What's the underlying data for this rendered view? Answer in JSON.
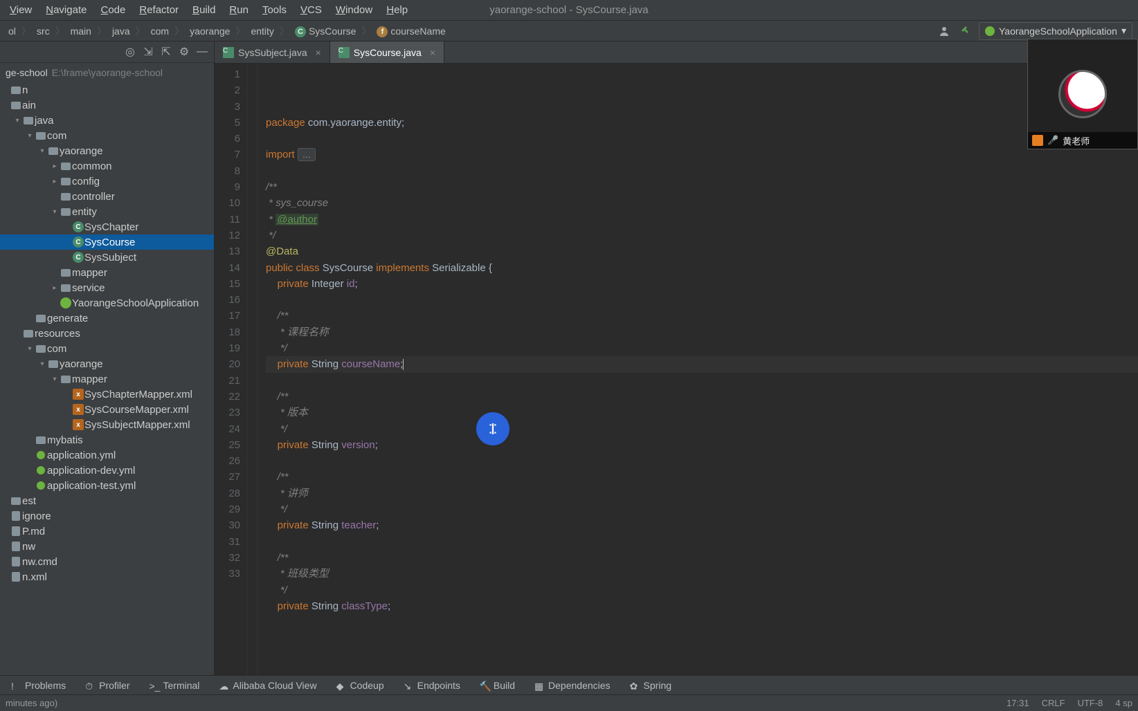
{
  "window_title": "yaorange-school - SysCourse.java",
  "menu": [
    "View",
    "Navigate",
    "Code",
    "Refactor",
    "Build",
    "Run",
    "Tools",
    "VCS",
    "Window",
    "Help"
  ],
  "breadcrumbs": {
    "parts": [
      "ol",
      "src",
      "main",
      "java",
      "com",
      "yaorange",
      "entity"
    ],
    "class_name": "SysCourse",
    "field_name": "courseName"
  },
  "run_config": "YaorangeSchoolApplication",
  "sidebar": {
    "project_name": "ge-school",
    "project_path": "E:\\frame\\yaorange-school",
    "tree": [
      {
        "depth": 0,
        "label": "n",
        "kind": "dir",
        "arrow": ""
      },
      {
        "depth": 0,
        "label": "ain",
        "kind": "dir",
        "arrow": ""
      },
      {
        "depth": 1,
        "label": "java",
        "kind": "dir",
        "arrow": "▾"
      },
      {
        "depth": 2,
        "label": "com",
        "kind": "dir",
        "arrow": "▾"
      },
      {
        "depth": 3,
        "label": "yaorange",
        "kind": "dir",
        "arrow": "▾"
      },
      {
        "depth": 4,
        "label": "common",
        "kind": "dir",
        "arrow": "▸"
      },
      {
        "depth": 4,
        "label": "config",
        "kind": "dir",
        "arrow": "▸"
      },
      {
        "depth": 4,
        "label": "controller",
        "kind": "dir",
        "arrow": ""
      },
      {
        "depth": 4,
        "label": "entity",
        "kind": "dir",
        "arrow": "▾"
      },
      {
        "depth": 5,
        "label": "SysChapter",
        "kind": "class",
        "arrow": ""
      },
      {
        "depth": 5,
        "label": "SysCourse",
        "kind": "class",
        "arrow": "",
        "selected": true
      },
      {
        "depth": 5,
        "label": "SysSubject",
        "kind": "class",
        "arrow": ""
      },
      {
        "depth": 4,
        "label": "mapper",
        "kind": "dir",
        "arrow": ""
      },
      {
        "depth": 4,
        "label": "service",
        "kind": "dir",
        "arrow": "▸"
      },
      {
        "depth": 4,
        "label": "YaorangeSchoolApplication",
        "kind": "spring",
        "arrow": ""
      },
      {
        "depth": 2,
        "label": "generate",
        "kind": "dir",
        "arrow": ""
      },
      {
        "depth": 1,
        "label": "resources",
        "kind": "dir",
        "arrow": ""
      },
      {
        "depth": 2,
        "label": "com",
        "kind": "dir",
        "arrow": "▾"
      },
      {
        "depth": 3,
        "label": "yaorange",
        "kind": "dir",
        "arrow": "▾"
      },
      {
        "depth": 4,
        "label": "mapper",
        "kind": "dir",
        "arrow": "▾"
      },
      {
        "depth": 5,
        "label": "SysChapterMapper.xml",
        "kind": "xml",
        "arrow": ""
      },
      {
        "depth": 5,
        "label": "SysCourseMapper.xml",
        "kind": "xml",
        "arrow": ""
      },
      {
        "depth": 5,
        "label": "SysSubjectMapper.xml",
        "kind": "xml",
        "arrow": ""
      },
      {
        "depth": 2,
        "label": "mybatis",
        "kind": "dir",
        "arrow": ""
      },
      {
        "depth": 2,
        "label": "application.yml",
        "kind": "yml",
        "arrow": ""
      },
      {
        "depth": 2,
        "label": "application-dev.yml",
        "kind": "yml",
        "arrow": ""
      },
      {
        "depth": 2,
        "label": "application-test.yml",
        "kind": "yml",
        "arrow": ""
      },
      {
        "depth": 0,
        "label": "est",
        "kind": "dir",
        "arrow": ""
      },
      {
        "depth": 0,
        "label": "ignore",
        "kind": "txt",
        "arrow": ""
      },
      {
        "depth": 0,
        "label": "P.md",
        "kind": "txt",
        "arrow": ""
      },
      {
        "depth": 0,
        "label": "nw",
        "kind": "txt",
        "arrow": ""
      },
      {
        "depth": 0,
        "label": "nw.cmd",
        "kind": "txt",
        "arrow": ""
      },
      {
        "depth": 0,
        "label": "n.xml",
        "kind": "txt",
        "arrow": ""
      }
    ]
  },
  "tabs": [
    {
      "label": "SysSubject.java",
      "icon": "class",
      "active": false
    },
    {
      "label": "SysCourse.java",
      "icon": "class",
      "active": true
    }
  ],
  "code_lines": [
    {
      "n": 1,
      "html": "<span class='kw'>package</span> com.yaorange.entity;"
    },
    {
      "n": 2,
      "html": ""
    },
    {
      "n": 3,
      "html": "<span class='kw'>import</span> <span class='fold'>...</span>"
    },
    {
      "n": 5,
      "html": ""
    },
    {
      "n": 6,
      "html": "<span class='cmt'>/**</span>"
    },
    {
      "n": 7,
      "html": "<span class='cmt'> * sys_course</span>"
    },
    {
      "n": 8,
      "html": "<span class='cmt'> * </span><span class='doctag'>@author</span>"
    },
    {
      "n": 9,
      "html": "<span class='cmt'> */</span>"
    },
    {
      "n": 10,
      "html": "<span class='ann'>@Data</span>"
    },
    {
      "n": 11,
      "html": "<span class='kw'>public class</span> SysCourse <span class='kw'>implements</span> Serializable {"
    },
    {
      "n": 12,
      "html": "    <span class='kw'>private</span> Integer <span class='name'>id</span>;"
    },
    {
      "n": 13,
      "html": ""
    },
    {
      "n": 14,
      "html": "    <span class='cmt'>/**</span>"
    },
    {
      "n": 15,
      "html": "    <span class='cmt'> * 课程名称</span>"
    },
    {
      "n": 16,
      "html": "    <span class='cmt'> */</span>"
    },
    {
      "n": 17,
      "html": "    <span class='kw'>private</span> String <span class='name'>courseName</span>;<span class='caret'></span>",
      "current": true
    },
    {
      "n": 18,
      "html": ""
    },
    {
      "n": 19,
      "html": "    <span class='cmt'>/**</span>"
    },
    {
      "n": 20,
      "html": "    <span class='cmt'> * 版本</span>"
    },
    {
      "n": 21,
      "html": "    <span class='cmt'> */</span>"
    },
    {
      "n": 22,
      "html": "    <span class='kw'>private</span> String <span class='name'>version</span>;"
    },
    {
      "n": 23,
      "html": ""
    },
    {
      "n": 24,
      "html": "    <span class='cmt'>/**</span>"
    },
    {
      "n": 25,
      "html": "    <span class='cmt'> * 讲师</span>"
    },
    {
      "n": 26,
      "html": "    <span class='cmt'> */</span>"
    },
    {
      "n": 27,
      "html": "    <span class='kw'>private</span> String <span class='name'>teacher</span>;"
    },
    {
      "n": 28,
      "html": ""
    },
    {
      "n": 29,
      "html": "    <span class='cmt'>/**</span>"
    },
    {
      "n": 30,
      "html": "    <span class='cmt'> * 班级类型</span>"
    },
    {
      "n": 31,
      "html": "    <span class='cmt'> */</span>"
    },
    {
      "n": 32,
      "html": "    <span class='kw'>private</span> String <span class='name'>classType</span>;"
    },
    {
      "n": 33,
      "html": ""
    }
  ],
  "video": {
    "speaker": "黄老师"
  },
  "bottom_tools": [
    {
      "label": "Problems",
      "icon": "!"
    },
    {
      "label": "Profiler",
      "icon": "⏱"
    },
    {
      "label": "Terminal",
      "icon": ">_"
    },
    {
      "label": "Alibaba Cloud View",
      "icon": "☁"
    },
    {
      "label": "Codeup",
      "icon": "◆"
    },
    {
      "label": "Endpoints",
      "icon": "↘"
    },
    {
      "label": "Build",
      "icon": "🔨"
    },
    {
      "label": "Dependencies",
      "icon": "▦"
    },
    {
      "label": "Spring",
      "icon": "✿"
    }
  ],
  "status": {
    "left": "minutes ago)",
    "pos": "17:31",
    "eol": "CRLF",
    "enc": "UTF-8",
    "indent": "4 sp"
  }
}
